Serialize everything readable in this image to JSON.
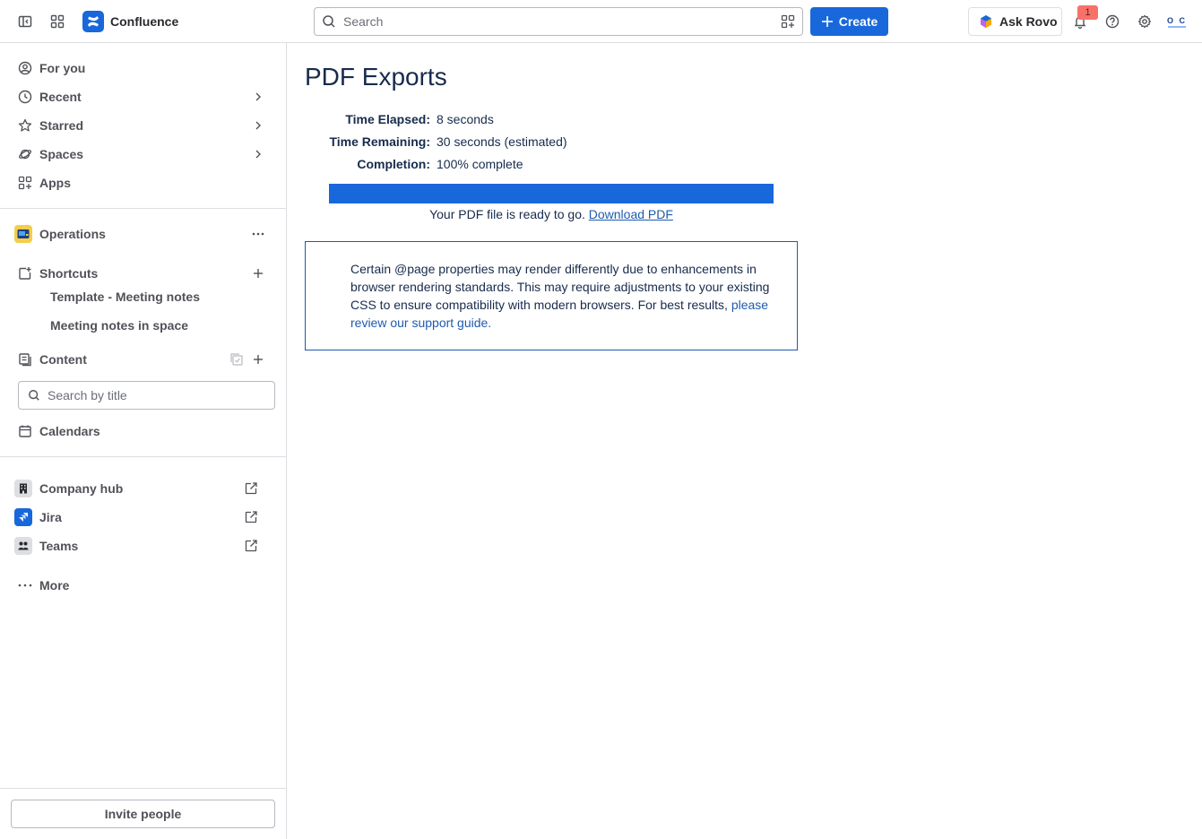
{
  "topbar": {
    "brand": "Confluence",
    "search_placeholder": "Search",
    "create_label": "Create",
    "rovo_label": "Ask Rovo",
    "notification_count": "1",
    "avatar_initials": "O C"
  },
  "sidebar": {
    "nav": [
      {
        "label": "For you",
        "icon": "person-circle-icon"
      },
      {
        "label": "Recent",
        "icon": "clock-icon"
      },
      {
        "label": "Starred",
        "icon": "star-icon"
      },
      {
        "label": "Spaces",
        "icon": "planet-icon"
      },
      {
        "label": "Apps",
        "icon": "apps-icon"
      }
    ],
    "space": {
      "label": "Operations"
    },
    "shortcuts": {
      "label": "Shortcuts",
      "items": [
        "Template - Meeting notes",
        "Meeting notes in space"
      ]
    },
    "content": {
      "label": "Content"
    },
    "search_placeholder": "Search by title",
    "calendars": {
      "label": "Calendars"
    },
    "apps": [
      {
        "label": "Company hub",
        "icon": "building-icon"
      },
      {
        "label": "Jira",
        "icon": "jira-icon"
      },
      {
        "label": "Teams",
        "icon": "teams-icon"
      }
    ],
    "more": {
      "label": "More"
    },
    "invite_label": "Invite people"
  },
  "main": {
    "title": "PDF Exports",
    "stats": [
      {
        "label": "Time Elapsed:",
        "value": "8 seconds"
      },
      {
        "label": "Time Remaining:",
        "value": "30 seconds (estimated)"
      },
      {
        "label": "Completion:",
        "value": "100% complete"
      }
    ],
    "progress": 1.0,
    "ready_text": "Your PDF file is ready to go.",
    "download_link": "Download PDF",
    "notice_text": "Certain @page properties may render differently due to enhancements in browser rendering standards. This may require adjustments to your existing CSS to ensure compatibility with modern browsers. For best results,",
    "notice_link": "please review our support guide."
  },
  "colors": {
    "accent": "#1868DB",
    "border": "#DDDEE1",
    "link": "#1D5BAE"
  }
}
